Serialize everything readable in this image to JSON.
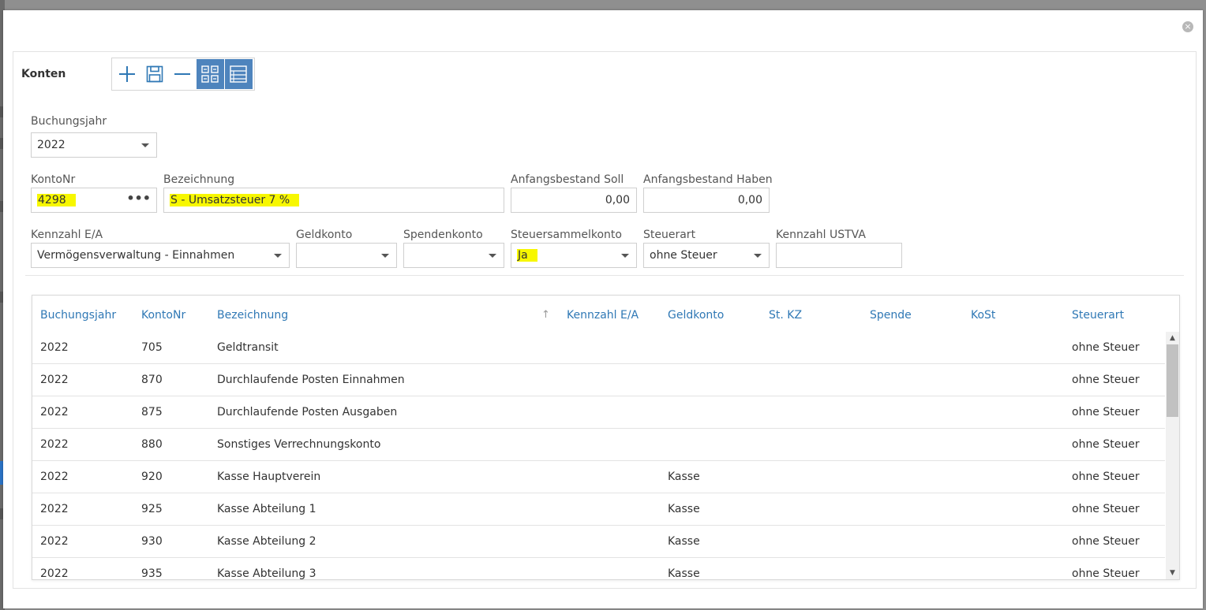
{
  "dialog": {
    "close_symbol": "×"
  },
  "panel": {
    "title": "Konten"
  },
  "toolbar": {
    "buttons": [
      {
        "name": "add",
        "icon": "plus-icon"
      },
      {
        "name": "save",
        "icon": "floppy-disk-icon"
      },
      {
        "name": "remove",
        "icon": "minus-icon"
      },
      {
        "name": "form-view",
        "icon": "form-grid-icon",
        "active": true
      },
      {
        "name": "list-view",
        "icon": "list-view-icon",
        "active": true
      }
    ],
    "accent_color": "#4e84bd"
  },
  "form": {
    "buchungsjahr": {
      "label": "Buchungsjahr",
      "value": "2022"
    },
    "kontonr": {
      "label": "KontoNr",
      "value": "4298",
      "button": "•••"
    },
    "bezeichnung": {
      "label": "Bezeichnung",
      "value": "S - Umsatzsteuer  7 %"
    },
    "anfangsbestand_soll": {
      "label": "Anfangsbestand Soll",
      "value": "0,00"
    },
    "anfangsbestand_haben": {
      "label": "Anfangsbestand Haben",
      "value": "0,00"
    },
    "kennzahl_ea": {
      "label": "Kennzahl E/A",
      "value": "Vermögensverwaltung - Einnahmen"
    },
    "geldkonto": {
      "label": "Geldkonto",
      "value": ""
    },
    "spendenkonto": {
      "label": "Spendenkonto",
      "value": ""
    },
    "steuersammelkonto": {
      "label": "Steuersammelkonto",
      "value": "Ja"
    },
    "steuerart": {
      "label": "Steuerart",
      "value": "ohne Steuer"
    },
    "kennzahl_ustva": {
      "label": "Kennzahl USTVA",
      "value": ""
    },
    "highlight_color": "#f7f700"
  },
  "grid": {
    "columns": [
      "Buchungsjahr",
      "KontoNr",
      "Bezeichnung",
      "Kennzahl E/A",
      "Geldkonto",
      "St. KZ",
      "Spende",
      "KoSt",
      "Steuerart"
    ],
    "sort_indicator": "↑",
    "header_color": "#2f78b5",
    "rows": [
      [
        "2022",
        "705",
        "Geldtransit",
        "",
        "",
        "",
        "",
        "",
        "ohne Steuer"
      ],
      [
        "2022",
        "870",
        "Durchlaufende Posten Einnahmen",
        "",
        "",
        "",
        "",
        "",
        "ohne Steuer"
      ],
      [
        "2022",
        "875",
        "Durchlaufende Posten Ausgaben",
        "",
        "",
        "",
        "",
        "",
        "ohne Steuer"
      ],
      [
        "2022",
        "880",
        "Sonstiges Verrechnungskonto",
        "",
        "",
        "",
        "",
        "",
        "ohne Steuer"
      ],
      [
        "2022",
        "920",
        "Kasse Hauptverein",
        "",
        "Kasse",
        "",
        "",
        "",
        "ohne Steuer"
      ],
      [
        "2022",
        "925",
        "Kasse Abteilung 1",
        "",
        "Kasse",
        "",
        "",
        "",
        "ohne Steuer"
      ],
      [
        "2022",
        "930",
        "Kasse Abteilung 2",
        "",
        "Kasse",
        "",
        "",
        "",
        "ohne Steuer"
      ],
      [
        "2022",
        "935",
        "Kasse Abteilung 3",
        "",
        "Kasse",
        "",
        "",
        "",
        "ohne Steuer"
      ]
    ]
  }
}
